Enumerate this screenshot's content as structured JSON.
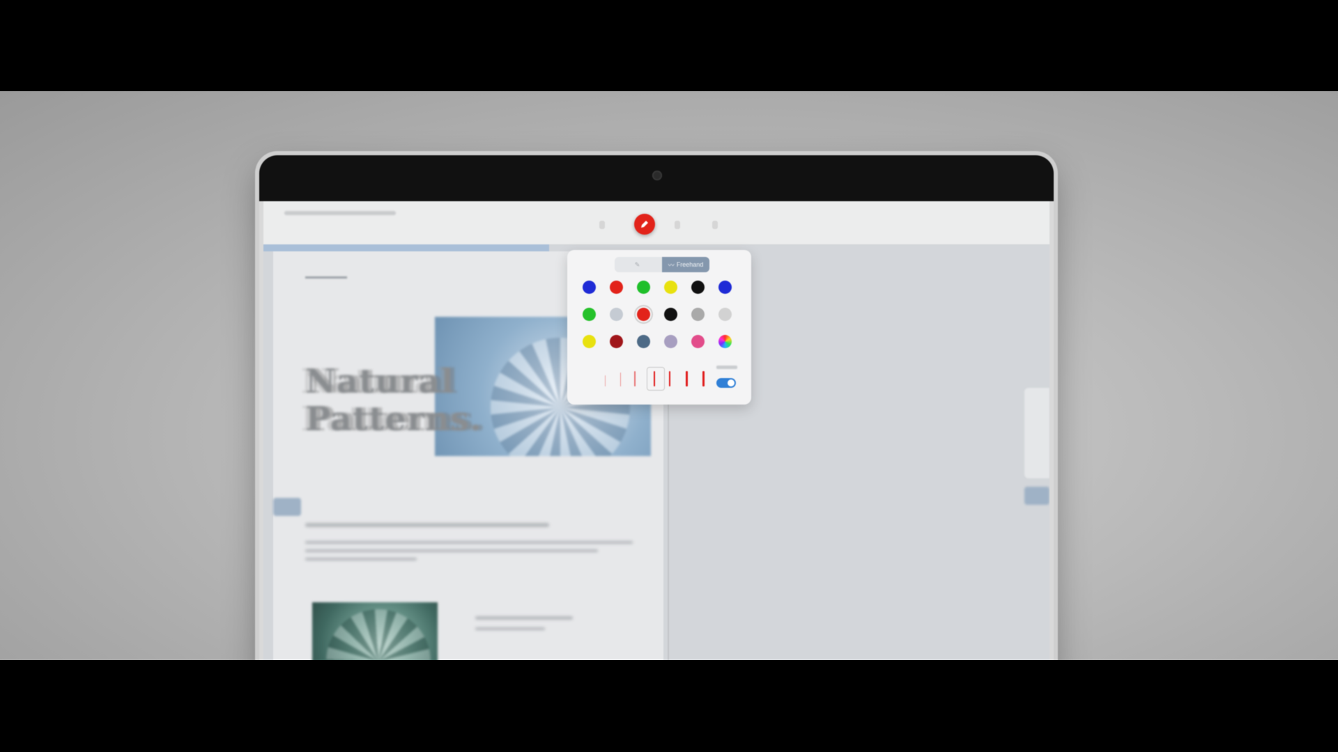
{
  "document": {
    "hero_title": "Natural Patterns."
  },
  "palette": {
    "modes": [
      {
        "label": "",
        "icon": "pen-tilt-icon",
        "active": false
      },
      {
        "label": "Freehand",
        "icon": "freehand-icon",
        "active": true
      }
    ],
    "colors": [
      "#1f2bd6",
      "#e2231a",
      "#1fbf2a",
      "#e8e10f",
      "#111111",
      "#1f2bd6",
      "#25c12a",
      "#c5cbd3",
      "#e2231a",
      "#111111",
      "#a9a9a9",
      "#d2d2d2",
      "#e8e10f",
      "#a0161a",
      "#4d6a86",
      "#a79ec0",
      "#e24c8a",
      "rainbow"
    ],
    "selected_color_index": 8,
    "stroke_color": "#e01b1b",
    "stroke_width_selected_index": 2,
    "toggle_on": true
  },
  "toolbar": {
    "active_tool_icon": "pen-icon",
    "active_tool_color": "#e2231a"
  }
}
